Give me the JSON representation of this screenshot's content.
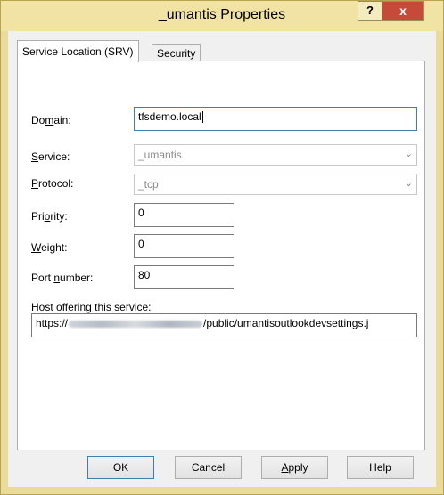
{
  "window": {
    "title": "_umantis Properties",
    "help_glyph": "?",
    "close_glyph": "x"
  },
  "tabs": [
    {
      "label": "Service Location (SRV)",
      "active": true
    },
    {
      "label": "Security",
      "active": false
    }
  ],
  "form": {
    "domain": {
      "label": "Domain:",
      "value": "tfsdemo.local"
    },
    "service": {
      "label": "Service:",
      "value": "_umantis"
    },
    "protocol": {
      "label": "Protocol:",
      "value": "_tcp"
    },
    "priority": {
      "label": "Priority:",
      "value": "0"
    },
    "weight": {
      "label": "Weight:",
      "value": "0"
    },
    "port": {
      "label": "Port number:",
      "value": "80"
    },
    "host": {
      "label": "Host offering this service:",
      "value_prefix": "https://",
      "value_suffix": "/public/umantisoutlookdevsettings.j"
    }
  },
  "buttons": {
    "ok": "OK",
    "cancel": "Cancel",
    "apply": "Apply",
    "help": "Help"
  },
  "colors": {
    "titlebar": "#f1e3a3",
    "close_button": "#c64a3a",
    "focus_border": "#3c7fb1"
  }
}
